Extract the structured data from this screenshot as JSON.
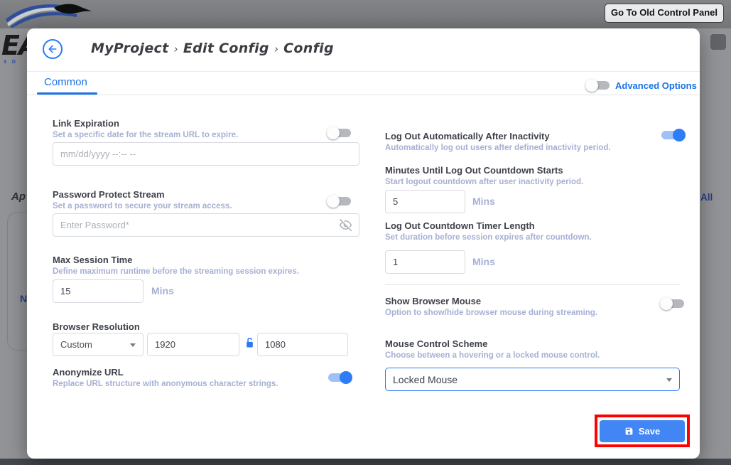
{
  "backdrop": {
    "top_button_label": "Go To Old Control Panel",
    "logo_partial_text": "EA",
    "logo_sub_text": "3 D",
    "left_heading_partial": "Ap",
    "left_button_partial": "N",
    "right_link_partial": "All"
  },
  "modal": {
    "breadcrumb": {
      "items": [
        "MyProject",
        "Edit Config",
        "Config"
      ],
      "separator": "›"
    },
    "tab_label": "Common",
    "advanced": {
      "label": "Advanced Options",
      "on": false
    },
    "fields": {
      "link_expiration": {
        "label": "Link Expiration",
        "desc": "Set a specific date for the stream URL to expire.",
        "placeholder": "mm/dd/yyyy --:-- --",
        "on": false
      },
      "password": {
        "label": "Password Protect Stream",
        "desc": "Set a password to secure your stream access.",
        "placeholder": "Enter Password*",
        "on": false
      },
      "max_session": {
        "label": "Max Session Time",
        "desc": "Define maximum runtime before the streaming session expires.",
        "value": "15",
        "unit": "Mins"
      },
      "resolution": {
        "label": "Browser Resolution",
        "preset": "Custom",
        "width": "1920",
        "height": "1080"
      },
      "anonymize": {
        "label": "Anonymize URL",
        "desc": "Replace URL structure with anonymous character strings.",
        "on": true
      },
      "auto_logout": {
        "label": "Log Out Automatically After Inactivity",
        "desc": "Automatically log out users after defined inactivity period.",
        "on": true
      },
      "countdown_start": {
        "label": "Minutes Until Log Out Countdown Starts",
        "desc": "Start logout countdown after user inactivity period.",
        "value": "5",
        "unit": "Mins"
      },
      "countdown_length": {
        "label": "Log Out Countdown Timer Length",
        "desc": "Set duration before session expires after countdown.",
        "value": "1",
        "unit": "Mins"
      },
      "show_mouse": {
        "label": "Show Browser Mouse",
        "desc": "Option to show/hide browser mouse during streaming.",
        "on": false
      },
      "mouse_scheme": {
        "label": "Mouse Control Scheme",
        "desc": "Choose between a hovering or a locked mouse control.",
        "value": "Locked Mouse"
      }
    },
    "save_label": "Save"
  },
  "colors": {
    "accent_blue": "#2979f7",
    "tab_blue": "#1a73e8",
    "save_blue": "#4286f5",
    "toggle_on_blue": "#2e7cf6",
    "description_text": "#a6b0d3",
    "annotation_red": "#fe0000"
  }
}
